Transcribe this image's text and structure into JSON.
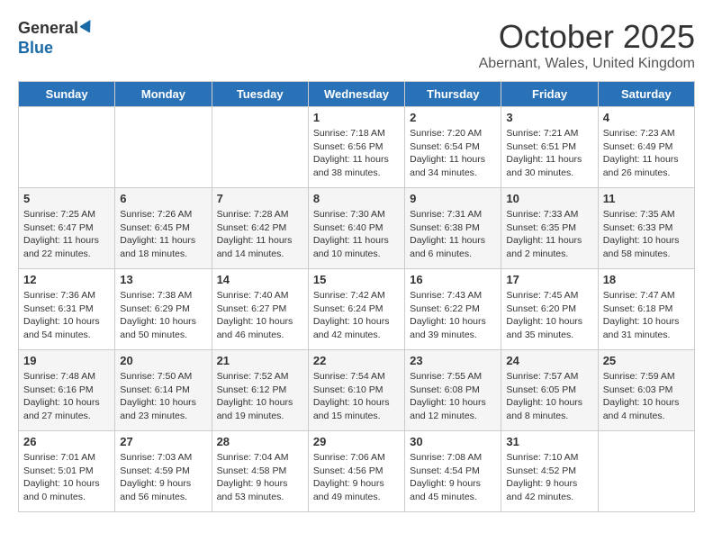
{
  "header": {
    "logo_general": "General",
    "logo_blue": "Blue",
    "month": "October 2025",
    "location": "Abernant, Wales, United Kingdom"
  },
  "weekdays": [
    "Sunday",
    "Monday",
    "Tuesday",
    "Wednesday",
    "Thursday",
    "Friday",
    "Saturday"
  ],
  "weeks": [
    [
      {
        "day": "",
        "sunrise": "",
        "sunset": "",
        "daylight": ""
      },
      {
        "day": "",
        "sunrise": "",
        "sunset": "",
        "daylight": ""
      },
      {
        "day": "",
        "sunrise": "",
        "sunset": "",
        "daylight": ""
      },
      {
        "day": "1",
        "sunrise": "Sunrise: 7:18 AM",
        "sunset": "Sunset: 6:56 PM",
        "daylight": "Daylight: 11 hours and 38 minutes."
      },
      {
        "day": "2",
        "sunrise": "Sunrise: 7:20 AM",
        "sunset": "Sunset: 6:54 PM",
        "daylight": "Daylight: 11 hours and 34 minutes."
      },
      {
        "day": "3",
        "sunrise": "Sunrise: 7:21 AM",
        "sunset": "Sunset: 6:51 PM",
        "daylight": "Daylight: 11 hours and 30 minutes."
      },
      {
        "day": "4",
        "sunrise": "Sunrise: 7:23 AM",
        "sunset": "Sunset: 6:49 PM",
        "daylight": "Daylight: 11 hours and 26 minutes."
      }
    ],
    [
      {
        "day": "5",
        "sunrise": "Sunrise: 7:25 AM",
        "sunset": "Sunset: 6:47 PM",
        "daylight": "Daylight: 11 hours and 22 minutes."
      },
      {
        "day": "6",
        "sunrise": "Sunrise: 7:26 AM",
        "sunset": "Sunset: 6:45 PM",
        "daylight": "Daylight: 11 hours and 18 minutes."
      },
      {
        "day": "7",
        "sunrise": "Sunrise: 7:28 AM",
        "sunset": "Sunset: 6:42 PM",
        "daylight": "Daylight: 11 hours and 14 minutes."
      },
      {
        "day": "8",
        "sunrise": "Sunrise: 7:30 AM",
        "sunset": "Sunset: 6:40 PM",
        "daylight": "Daylight: 11 hours and 10 minutes."
      },
      {
        "day": "9",
        "sunrise": "Sunrise: 7:31 AM",
        "sunset": "Sunset: 6:38 PM",
        "daylight": "Daylight: 11 hours and 6 minutes."
      },
      {
        "day": "10",
        "sunrise": "Sunrise: 7:33 AM",
        "sunset": "Sunset: 6:35 PM",
        "daylight": "Daylight: 11 hours and 2 minutes."
      },
      {
        "day": "11",
        "sunrise": "Sunrise: 7:35 AM",
        "sunset": "Sunset: 6:33 PM",
        "daylight": "Daylight: 10 hours and 58 minutes."
      }
    ],
    [
      {
        "day": "12",
        "sunrise": "Sunrise: 7:36 AM",
        "sunset": "Sunset: 6:31 PM",
        "daylight": "Daylight: 10 hours and 54 minutes."
      },
      {
        "day": "13",
        "sunrise": "Sunrise: 7:38 AM",
        "sunset": "Sunset: 6:29 PM",
        "daylight": "Daylight: 10 hours and 50 minutes."
      },
      {
        "day": "14",
        "sunrise": "Sunrise: 7:40 AM",
        "sunset": "Sunset: 6:27 PM",
        "daylight": "Daylight: 10 hours and 46 minutes."
      },
      {
        "day": "15",
        "sunrise": "Sunrise: 7:42 AM",
        "sunset": "Sunset: 6:24 PM",
        "daylight": "Daylight: 10 hours and 42 minutes."
      },
      {
        "day": "16",
        "sunrise": "Sunrise: 7:43 AM",
        "sunset": "Sunset: 6:22 PM",
        "daylight": "Daylight: 10 hours and 39 minutes."
      },
      {
        "day": "17",
        "sunrise": "Sunrise: 7:45 AM",
        "sunset": "Sunset: 6:20 PM",
        "daylight": "Daylight: 10 hours and 35 minutes."
      },
      {
        "day": "18",
        "sunrise": "Sunrise: 7:47 AM",
        "sunset": "Sunset: 6:18 PM",
        "daylight": "Daylight: 10 hours and 31 minutes."
      }
    ],
    [
      {
        "day": "19",
        "sunrise": "Sunrise: 7:48 AM",
        "sunset": "Sunset: 6:16 PM",
        "daylight": "Daylight: 10 hours and 27 minutes."
      },
      {
        "day": "20",
        "sunrise": "Sunrise: 7:50 AM",
        "sunset": "Sunset: 6:14 PM",
        "daylight": "Daylight: 10 hours and 23 minutes."
      },
      {
        "day": "21",
        "sunrise": "Sunrise: 7:52 AM",
        "sunset": "Sunset: 6:12 PM",
        "daylight": "Daylight: 10 hours and 19 minutes."
      },
      {
        "day": "22",
        "sunrise": "Sunrise: 7:54 AM",
        "sunset": "Sunset: 6:10 PM",
        "daylight": "Daylight: 10 hours and 15 minutes."
      },
      {
        "day": "23",
        "sunrise": "Sunrise: 7:55 AM",
        "sunset": "Sunset: 6:08 PM",
        "daylight": "Daylight: 10 hours and 12 minutes."
      },
      {
        "day": "24",
        "sunrise": "Sunrise: 7:57 AM",
        "sunset": "Sunset: 6:05 PM",
        "daylight": "Daylight: 10 hours and 8 minutes."
      },
      {
        "day": "25",
        "sunrise": "Sunrise: 7:59 AM",
        "sunset": "Sunset: 6:03 PM",
        "daylight": "Daylight: 10 hours and 4 minutes."
      }
    ],
    [
      {
        "day": "26",
        "sunrise": "Sunrise: 7:01 AM",
        "sunset": "Sunset: 5:01 PM",
        "daylight": "Daylight: 10 hours and 0 minutes."
      },
      {
        "day": "27",
        "sunrise": "Sunrise: 7:03 AM",
        "sunset": "Sunset: 4:59 PM",
        "daylight": "Daylight: 9 hours and 56 minutes."
      },
      {
        "day": "28",
        "sunrise": "Sunrise: 7:04 AM",
        "sunset": "Sunset: 4:58 PM",
        "daylight": "Daylight: 9 hours and 53 minutes."
      },
      {
        "day": "29",
        "sunrise": "Sunrise: 7:06 AM",
        "sunset": "Sunset: 4:56 PM",
        "daylight": "Daylight: 9 hours and 49 minutes."
      },
      {
        "day": "30",
        "sunrise": "Sunrise: 7:08 AM",
        "sunset": "Sunset: 4:54 PM",
        "daylight": "Daylight: 9 hours and 45 minutes."
      },
      {
        "day": "31",
        "sunrise": "Sunrise: 7:10 AM",
        "sunset": "Sunset: 4:52 PM",
        "daylight": "Daylight: 9 hours and 42 minutes."
      },
      {
        "day": "",
        "sunrise": "",
        "sunset": "",
        "daylight": ""
      }
    ]
  ]
}
